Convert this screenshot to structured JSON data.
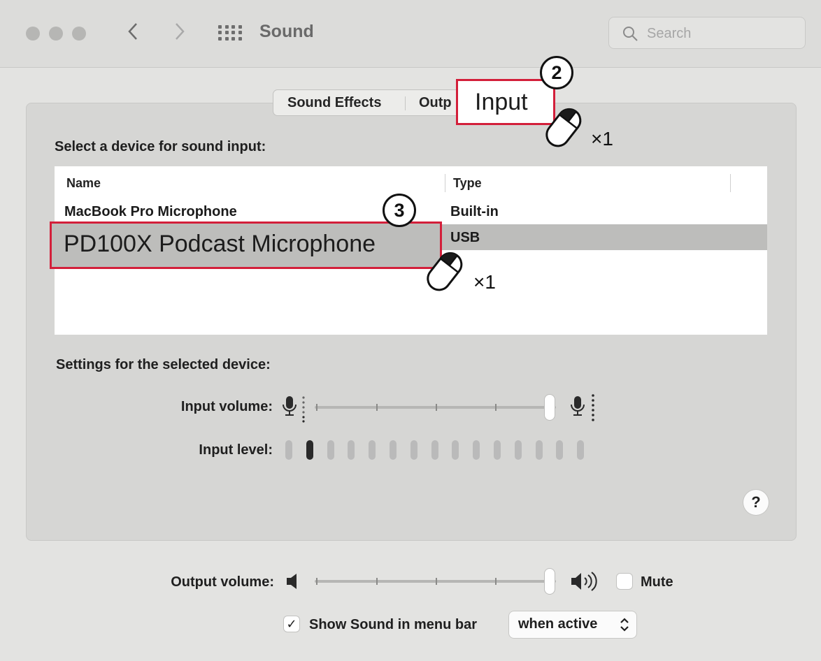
{
  "window": {
    "title": "Sound",
    "search_placeholder": "Search",
    "back_glyph": "‹",
    "forward_glyph": "›"
  },
  "tabs": [
    {
      "label": "Sound Effects"
    },
    {
      "label": "Outp"
    },
    {
      "label": "Input"
    }
  ],
  "annotations": {
    "step2": "2",
    "step3": "3",
    "click_count": "×1"
  },
  "input": {
    "section_label": "Select a device for sound input:",
    "columns": {
      "name": "Name",
      "type": "Type"
    },
    "devices": [
      {
        "name": "MacBook Pro Microphone",
        "type": "Built-in"
      },
      {
        "name": "PD100X Podcast Microphone",
        "type": "USB"
      }
    ],
    "selected_index": 1,
    "settings_label": "Settings for the selected device:",
    "volume_label": "Input volume:",
    "level_label": "Input level:",
    "volume_fraction": 1.0,
    "level_total": 15,
    "level_active": 1
  },
  "output": {
    "volume_label": "Output volume:",
    "volume_fraction": 1.0,
    "mute_label": "Mute",
    "mute_checked": false
  },
  "menubar": {
    "label": "Show Sound in menu bar",
    "checked": true,
    "popup_value": "when active",
    "check_glyph": "✓"
  },
  "help_label": "?",
  "colors": {
    "callout": "#d31f3a",
    "selected_row": "#bdbdbb"
  },
  "icons": [
    "search-icon",
    "grid-icon",
    "back-icon",
    "forward-icon",
    "mic-low-icon",
    "mic-high-icon",
    "speaker-low-icon",
    "speaker-high-icon",
    "mouse-icon",
    "chevron-updown-icon"
  ]
}
